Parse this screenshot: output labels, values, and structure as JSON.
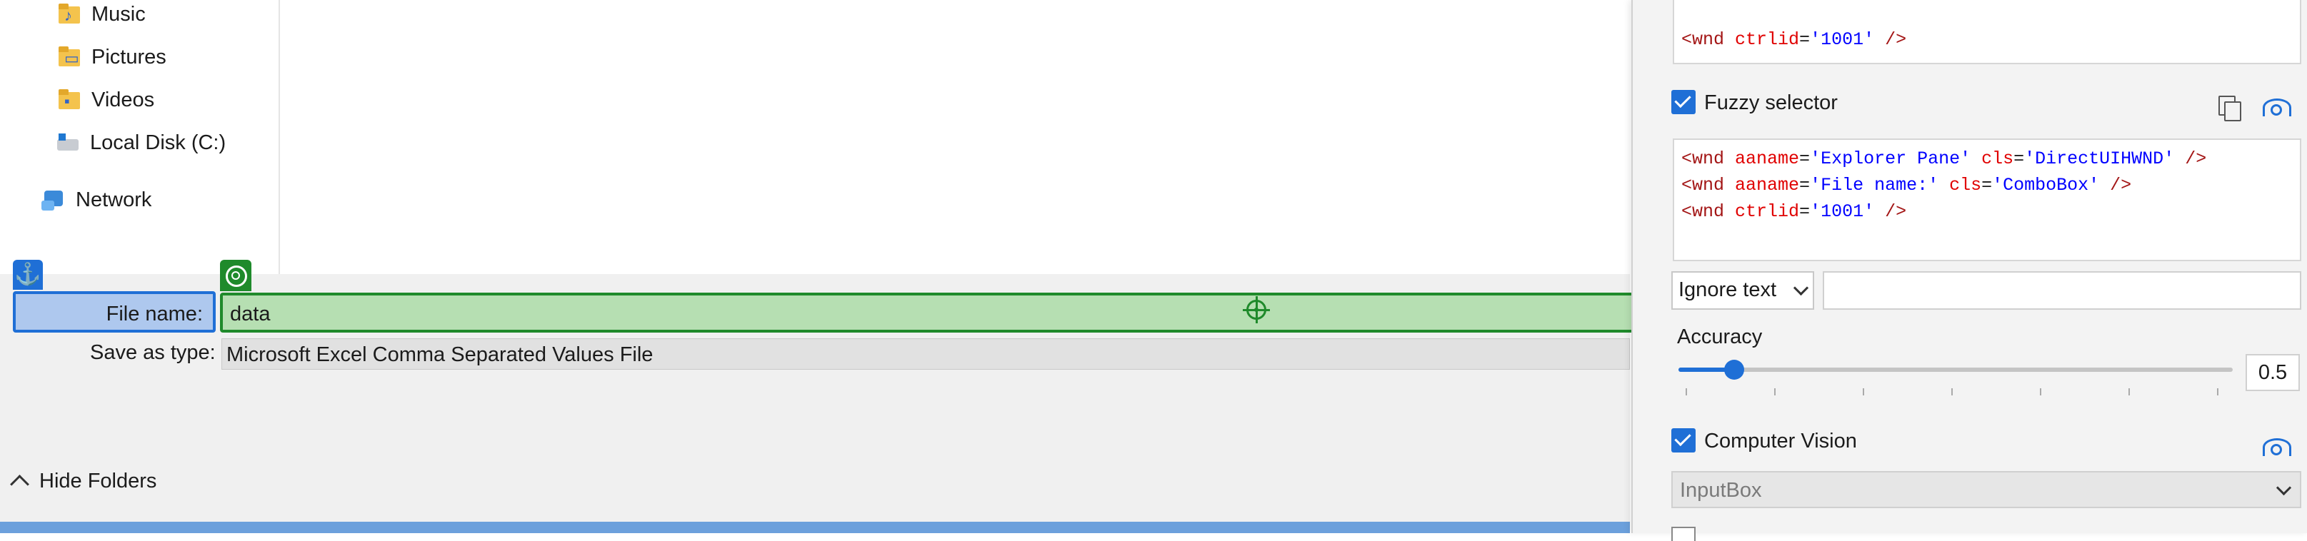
{
  "nav": {
    "items": [
      {
        "label": "Music",
        "icon": "music-folder-icon"
      },
      {
        "label": "Pictures",
        "icon": "pictures-folder-icon"
      },
      {
        "label": "Videos",
        "icon": "videos-folder-icon"
      },
      {
        "label": "Local Disk (C:)",
        "icon": "local-disk-icon"
      },
      {
        "label": "Network",
        "icon": "network-icon"
      }
    ]
  },
  "dialog": {
    "file_name_label": "File name:",
    "file_name_value": "data",
    "save_type_label": "Save as type:",
    "save_type_value": "Microsoft Excel Comma Separated Values File",
    "hide_folders_label": "Hide Folders"
  },
  "panel": {
    "top_selector_lines": [
      {
        "tag": "<wnd",
        "attrs": [
          {
            "name": "ctrlid",
            "value": "'1001'"
          }
        ],
        "close": " />"
      }
    ],
    "fuzzy_selector_label": "Fuzzy selector",
    "fuzzy_selector_checked": true,
    "fuzzy_lines": [
      {
        "tag": "<wnd",
        "attrs": [
          {
            "name": "aaname",
            "value": "'Explorer Pane'"
          },
          {
            "name": "cls",
            "value": "'DirectUIHWND'"
          }
        ],
        "close": " />"
      },
      {
        "tag": "<wnd",
        "attrs": [
          {
            "name": "aaname",
            "value": "'File name:'"
          },
          {
            "name": "cls",
            "value": "'ComboBox'"
          }
        ],
        "close": " />"
      },
      {
        "tag": "<wnd",
        "attrs": [
          {
            "name": "ctrlid",
            "value": "'1001'"
          }
        ],
        "close": " />"
      }
    ],
    "text_mode_value": "Ignore text",
    "text_value": "",
    "accuracy_label": "Accuracy",
    "accuracy_value": "0.5",
    "accuracy_fraction": 0.5,
    "computer_vision_label": "Computer Vision",
    "computer_vision_checked": true,
    "cv_type_value": "InputBox"
  },
  "colors": {
    "anchor_blue": "#1f6fd6",
    "target_green": "#1f8a2b",
    "label_highlight": "#aec8ee",
    "target_highlight": "#b6dfb2"
  }
}
